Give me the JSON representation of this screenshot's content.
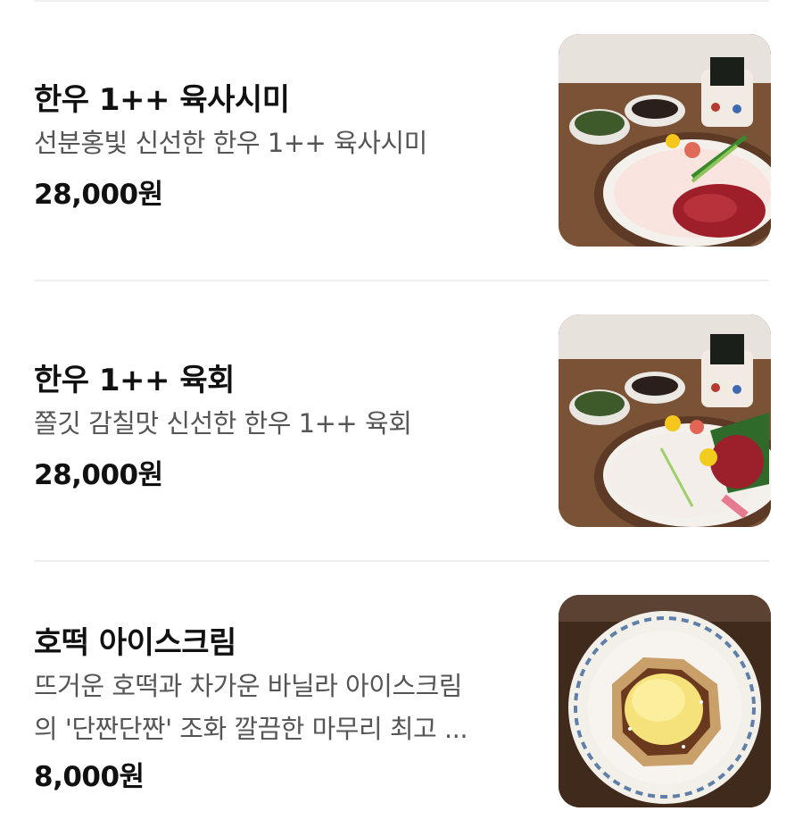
{
  "menu": {
    "items": [
      {
        "title": "한우 1++ 육사시미",
        "desc_line1": "선분홍빛 신선한 한우 1++ 육사시미",
        "desc_line2": "",
        "price": "28,000원",
        "photo_icon": "yuk-sashimi-photo"
      },
      {
        "title": "한우 1++ 육회",
        "desc_line1": "쫄깃 감칠맛 신선한 한우 1++ 육회",
        "desc_line2": "",
        "price": "28,000원",
        "photo_icon": "yukhoe-photo"
      },
      {
        "title": "호떡 아이스크림",
        "desc_line1": "뜨거운 호떡과 차가운 바닐라 아이스크림",
        "desc_line2": "의 '단짠단짠' 조화 깔끔한 마무리 최고 ...",
        "price": "8,000원",
        "photo_icon": "hotteok-icecream-photo"
      }
    ]
  },
  "colors": {
    "title": "#111111",
    "description": "#555555",
    "divider": "#efefef",
    "background": "#ffffff"
  }
}
